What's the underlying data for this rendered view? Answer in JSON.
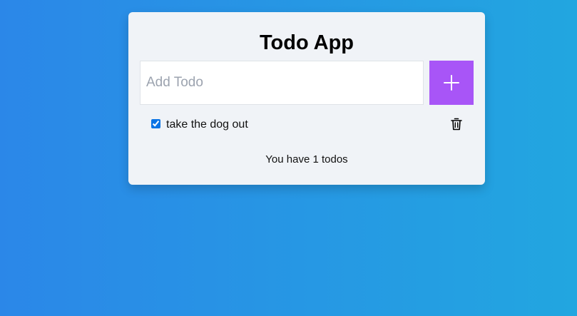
{
  "app": {
    "title": "Todo App"
  },
  "input": {
    "placeholder": "Add Todo",
    "value": ""
  },
  "add_button": {
    "icon": "plus-icon"
  },
  "todos": [
    {
      "text": "take the dog out",
      "done": true
    }
  ],
  "footer": {
    "count_text": "You have 1 todos"
  },
  "colors": {
    "background_start": "#2b87e8",
    "background_end": "#22a6e0",
    "card": "#f0f3f7",
    "accent": "#a855f7",
    "checkbox": "#0b74e5"
  }
}
